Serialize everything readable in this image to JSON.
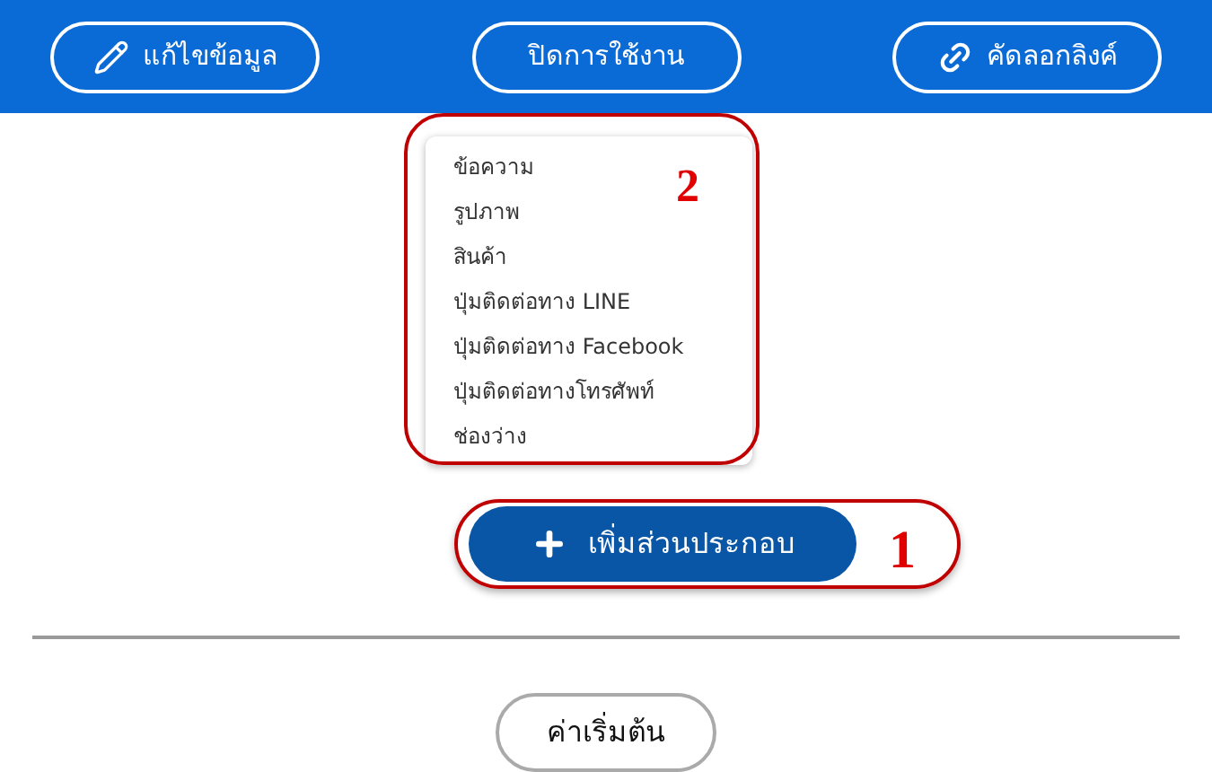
{
  "toolbar": {
    "buttons": [
      {
        "kind": "edit",
        "label": "แก้ไขข้อมูล"
      },
      {
        "kind": "plain",
        "label": "ปิดการใช้งาน"
      },
      {
        "kind": "link",
        "label": "คัดลอกลิงค์"
      }
    ]
  },
  "menu": {
    "items": [
      "ข้อความ",
      "รูปภาพ",
      "สินค้า",
      "ปุ่มติดต่อทาง LINE",
      "ปุ่มติดต่อทาง Facebook",
      "ปุ่มติดต่อทางโทรศัพท์",
      "ช่องว่าง"
    ]
  },
  "add_button": {
    "label": "เพิ่มส่วนประกอบ"
  },
  "annotations": [
    "2",
    "1"
  ],
  "reset_button": {
    "label": "ค่าเริ่มต้น"
  }
}
